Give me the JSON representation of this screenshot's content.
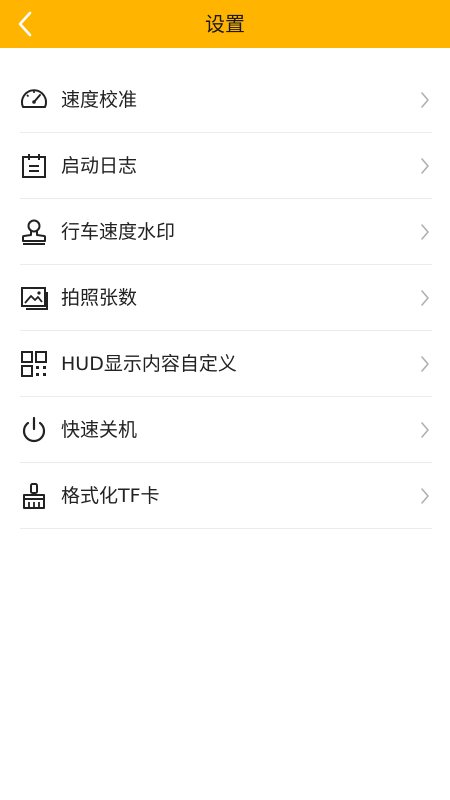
{
  "header": {
    "title": "设置",
    "background_color": "#FFB400",
    "back_icon": "chevron-left-icon"
  },
  "settings": {
    "items": [
      {
        "label": "速度校准",
        "icon": "speedometer-icon"
      },
      {
        "label": "启动日志",
        "icon": "calendar-log-icon"
      },
      {
        "label": "行车速度水印",
        "icon": "stamp-icon"
      },
      {
        "label": "拍照张数",
        "icon": "photos-icon"
      },
      {
        "label": "HUD显示内容自定义",
        "icon": "qr-grid-icon"
      },
      {
        "label": "快速关机",
        "icon": "power-icon"
      },
      {
        "label": "格式化TF卡",
        "icon": "brush-icon"
      }
    ]
  }
}
